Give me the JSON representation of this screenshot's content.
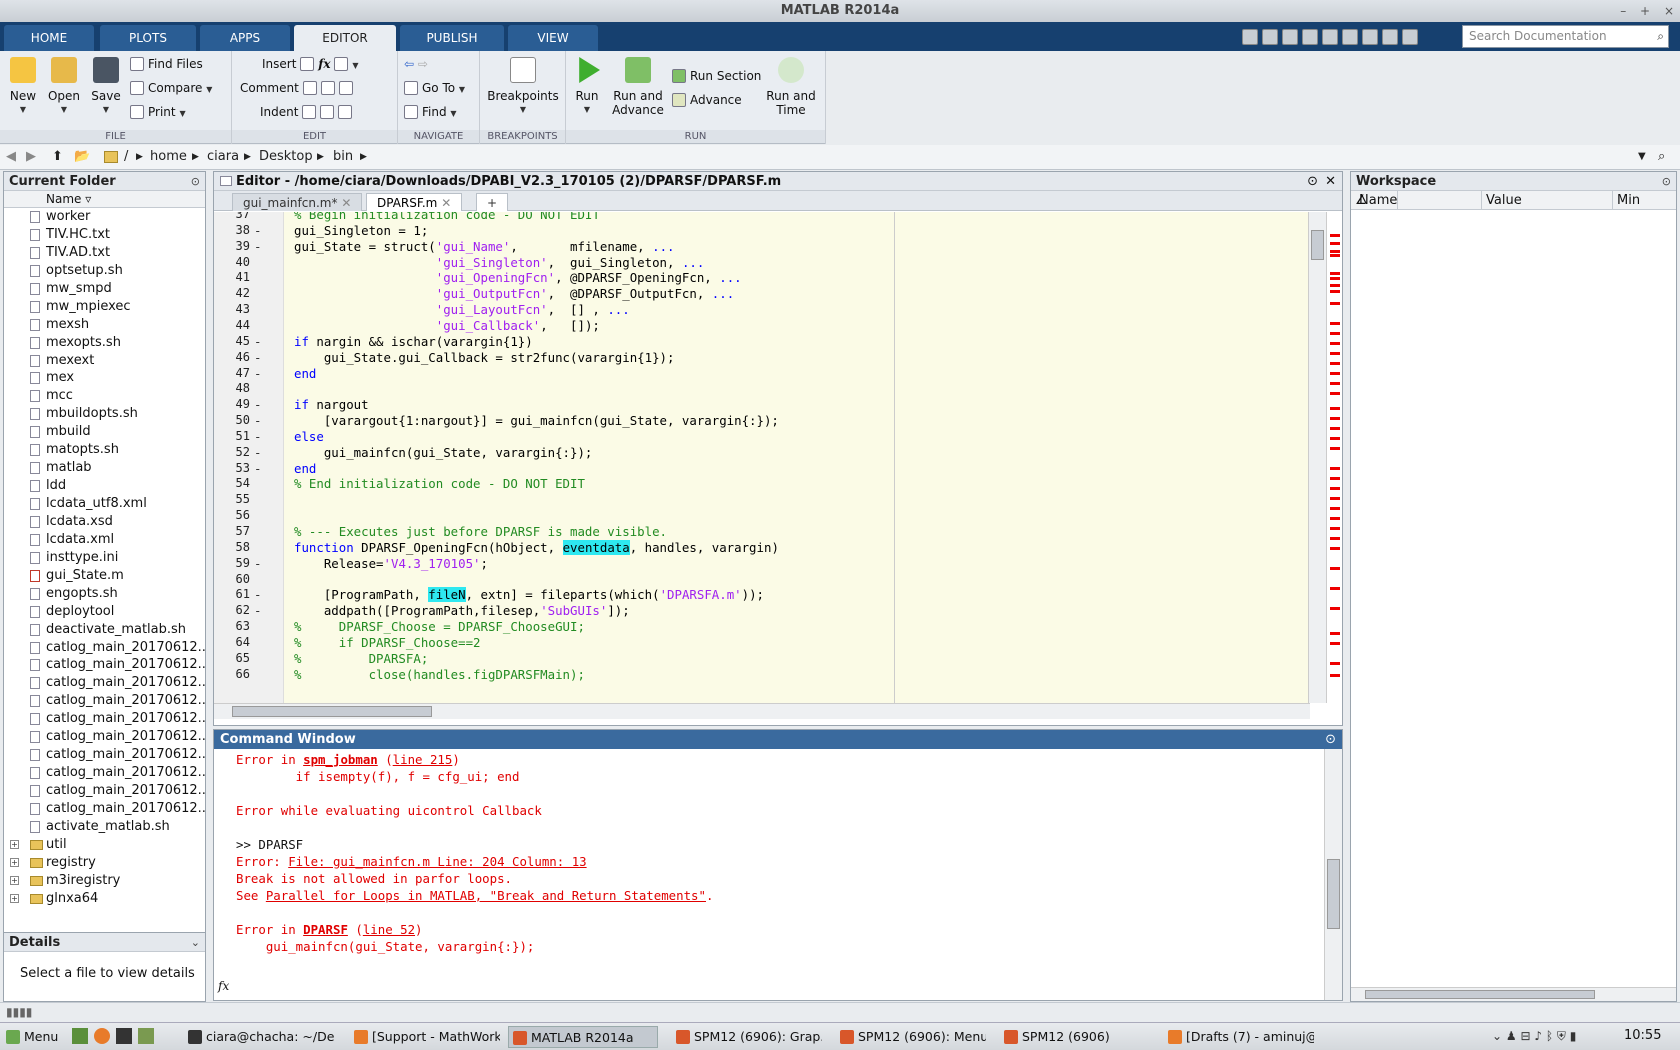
{
  "window": {
    "title": "MATLAB R2014a",
    "controls": [
      "–",
      "+",
      "×"
    ]
  },
  "ribbon_tabs": [
    {
      "label": "HOME"
    },
    {
      "label": "PLOTS"
    },
    {
      "label": "APPS"
    },
    {
      "label": "EDITOR"
    },
    {
      "label": "PUBLISH"
    },
    {
      "label": "VIEW"
    }
  ],
  "ribbon": {
    "file": {
      "section": "FILE",
      "new": "New",
      "open": "Open",
      "save": "Save",
      "find_files": "Find Files",
      "compare": "Compare",
      "print": "Print"
    },
    "edit": {
      "section": "EDIT",
      "insert": "Insert",
      "comment": "Comment",
      "indent": "Indent",
      "fx": "fx"
    },
    "navigate": {
      "section": "NAVIGATE",
      "goto": "Go To",
      "find": "Find"
    },
    "breakpoints": {
      "section": "BREAKPOINTS",
      "label": "Breakpoints"
    },
    "run": {
      "section": "RUN",
      "run": "Run",
      "run_advance_1": "Run and",
      "run_advance_2": "Advance",
      "run_section": "Run Section",
      "advance": "Advance",
      "run_time_1": "Run and",
      "run_time_2": "Time"
    }
  },
  "search": {
    "placeholder": "Search Documentation"
  },
  "address": {
    "crumbs": [
      "/",
      "home",
      "ciara",
      "Desktop",
      "bin"
    ]
  },
  "current_folder": {
    "title": "Current Folder",
    "column": "Name",
    "files": [
      "worker",
      "TIV.HC.txt",
      "TIV.AD.txt",
      "optsetup.sh",
      "mw_smpd",
      "mw_mpiexec",
      "mexsh",
      "mexopts.sh",
      "mexext",
      "mex",
      "mcc",
      "mbuildopts.sh",
      "mbuild",
      "matopts.sh",
      "matlab",
      "ldd",
      "lcdata_utf8.xml",
      "lcdata.xsd",
      "lcdata.xml",
      "insttype.ini",
      "gui_State.m",
      "engopts.sh",
      "deploytool",
      "deactivate_matlab.sh",
      "catlog_main_20170612...",
      "catlog_main_20170612...",
      "catlog_main_20170612...",
      "catlog_main_20170612...",
      "catlog_main_20170612...",
      "catlog_main_20170612...",
      "catlog_main_20170612...",
      "catlog_main_20170612...",
      "catlog_main_20170612...",
      "catlog_main_20170612...",
      "activate_matlab.sh"
    ],
    "folders": [
      "util",
      "registry",
      "m3iregistry",
      "glnxa64"
    ]
  },
  "details": {
    "title": "Details",
    "text": "Select a file to view details"
  },
  "editor": {
    "title": "Editor - /home/ciara/Downloads/DPABI_V2.3_170105 (2)/DPARSF/DPARSF.m",
    "tabs": [
      {
        "label": "gui_mainfcn.m*"
      },
      {
        "label": "DPARSF.m"
      }
    ],
    "add_tab": "+",
    "lines": [
      {
        "n": "37",
        "d": ""
      },
      {
        "n": "38",
        "d": "-"
      },
      {
        "n": "39",
        "d": "-"
      },
      {
        "n": "40",
        "d": ""
      },
      {
        "n": "41",
        "d": ""
      },
      {
        "n": "42",
        "d": ""
      },
      {
        "n": "43",
        "d": ""
      },
      {
        "n": "44",
        "d": ""
      },
      {
        "n": "45",
        "d": "-"
      },
      {
        "n": "46",
        "d": "-"
      },
      {
        "n": "47",
        "d": "-"
      },
      {
        "n": "48",
        "d": ""
      },
      {
        "n": "49",
        "d": "-"
      },
      {
        "n": "50",
        "d": "-"
      },
      {
        "n": "51",
        "d": "-"
      },
      {
        "n": "52",
        "d": "-"
      },
      {
        "n": "53",
        "d": "-"
      },
      {
        "n": "54",
        "d": ""
      },
      {
        "n": "55",
        "d": ""
      },
      {
        "n": "56",
        "d": ""
      },
      {
        "n": "57",
        "d": ""
      },
      {
        "n": "58",
        "d": ""
      },
      {
        "n": "59",
        "d": "-"
      },
      {
        "n": "60",
        "d": ""
      },
      {
        "n": "61",
        "d": "-"
      },
      {
        "n": "62",
        "d": "-"
      },
      {
        "n": "63",
        "d": ""
      },
      {
        "n": "64",
        "d": ""
      },
      {
        "n": "65",
        "d": ""
      },
      {
        "n": "66",
        "d": ""
      }
    ]
  },
  "command_window": {
    "title": "Command Window",
    "fx": "fx"
  },
  "workspace": {
    "title": "Workspace",
    "columns": [
      "Name",
      "Value",
      "Min"
    ]
  },
  "taskbar": {
    "menu": "Menu",
    "tasks": [
      {
        "label": "ciara@chacha: ~/Desk..."
      },
      {
        "label": "[Support - MathWork..."
      },
      {
        "label": "MATLAB R2014a"
      },
      {
        "label": "SPM12 (6906): Grap..."
      },
      {
        "label": "SPM12 (6906): Menu"
      },
      {
        "label": "SPM12 (6906)"
      },
      {
        "label": "[Drafts (7) - aminuj@..."
      }
    ],
    "clock": "10:55"
  }
}
